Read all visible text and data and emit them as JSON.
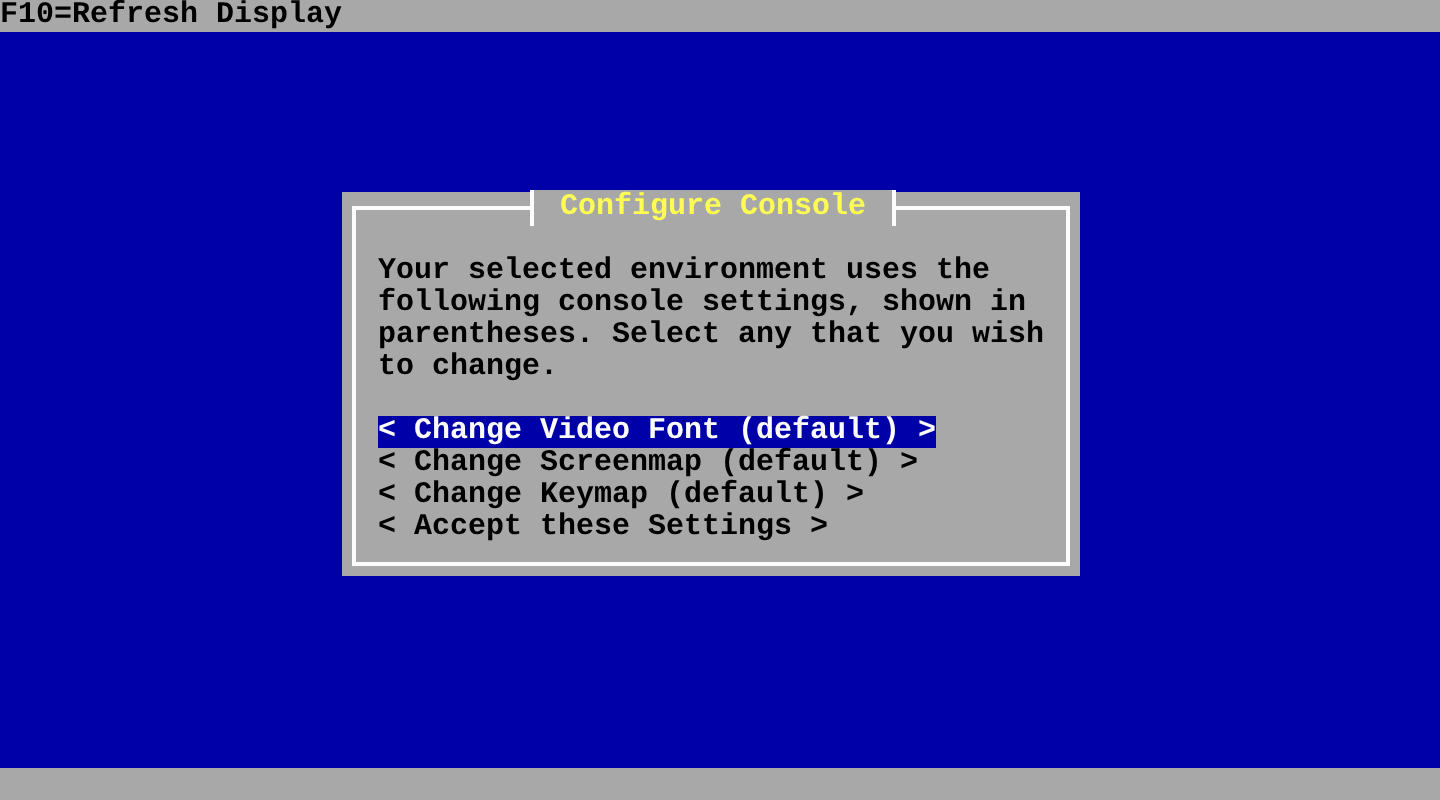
{
  "top_bar": {
    "text": "F10=Refresh Display"
  },
  "dialog": {
    "title": "Configure Console",
    "message": "Your selected environment uses the following console settings, shown in parentheses. Select any that you wish to change.",
    "options": [
      {
        "label": "< Change Video Font (default) >",
        "selected": true
      },
      {
        "label": "< Change Screenmap (default) >",
        "selected": false
      },
      {
        "label": "< Change Keymap (default) >",
        "selected": false
      },
      {
        "label": "< Accept these Settings >",
        "selected": false
      }
    ]
  }
}
